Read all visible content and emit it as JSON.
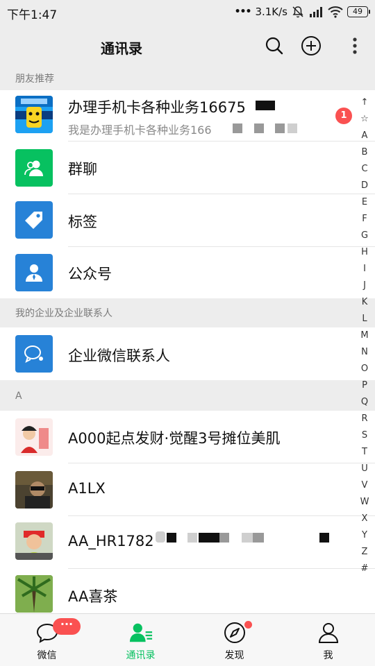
{
  "status_bar": {
    "time": "下午1:47",
    "network_speed": "3.1K/s",
    "battery": "49"
  },
  "nav": {
    "title": "通讯录"
  },
  "sections": {
    "friend_recommend": "朋友推荐",
    "enterprise": "我的企业及企业联系人",
    "letter_a": "A"
  },
  "recommend": {
    "title": "办理手机卡各种业务16675",
    "subtitle": "我是办理手机卡各种业务166",
    "badge": "1"
  },
  "functions": [
    {
      "label": "群聊",
      "icon": "group-chat-icon",
      "color": "#07c160"
    },
    {
      "label": "标签",
      "icon": "tag-icon",
      "color": "#2782d7"
    },
    {
      "label": "公众号",
      "icon": "official-account-icon",
      "color": "#2782d7"
    }
  ],
  "enterprise_contact": {
    "label": "企业微信联系人",
    "icon": "enterprise-chat-icon",
    "color": "#2782d7"
  },
  "contacts": [
    {
      "name": "A000起点发财·觉醒3号摊位美肌"
    },
    {
      "name": "A1LX"
    },
    {
      "name": "AA_HR1782"
    },
    {
      "name": "AA喜茶"
    }
  ],
  "index_letters": [
    "↑",
    "☆",
    "A",
    "B",
    "C",
    "D",
    "E",
    "F",
    "G",
    "H",
    "I",
    "J",
    "K",
    "L",
    "M",
    "N",
    "O",
    "P",
    "Q",
    "R",
    "S",
    "T",
    "U",
    "V",
    "W",
    "X",
    "Y",
    "Z",
    "#"
  ],
  "tabs": [
    {
      "label": "微信",
      "badge": "···"
    },
    {
      "label": "通讯录"
    },
    {
      "label": "发现"
    },
    {
      "label": "我"
    }
  ],
  "colors": {
    "accent_green": "#07c160",
    "badge_red": "#fa5151",
    "icon_blue": "#2782d7"
  }
}
